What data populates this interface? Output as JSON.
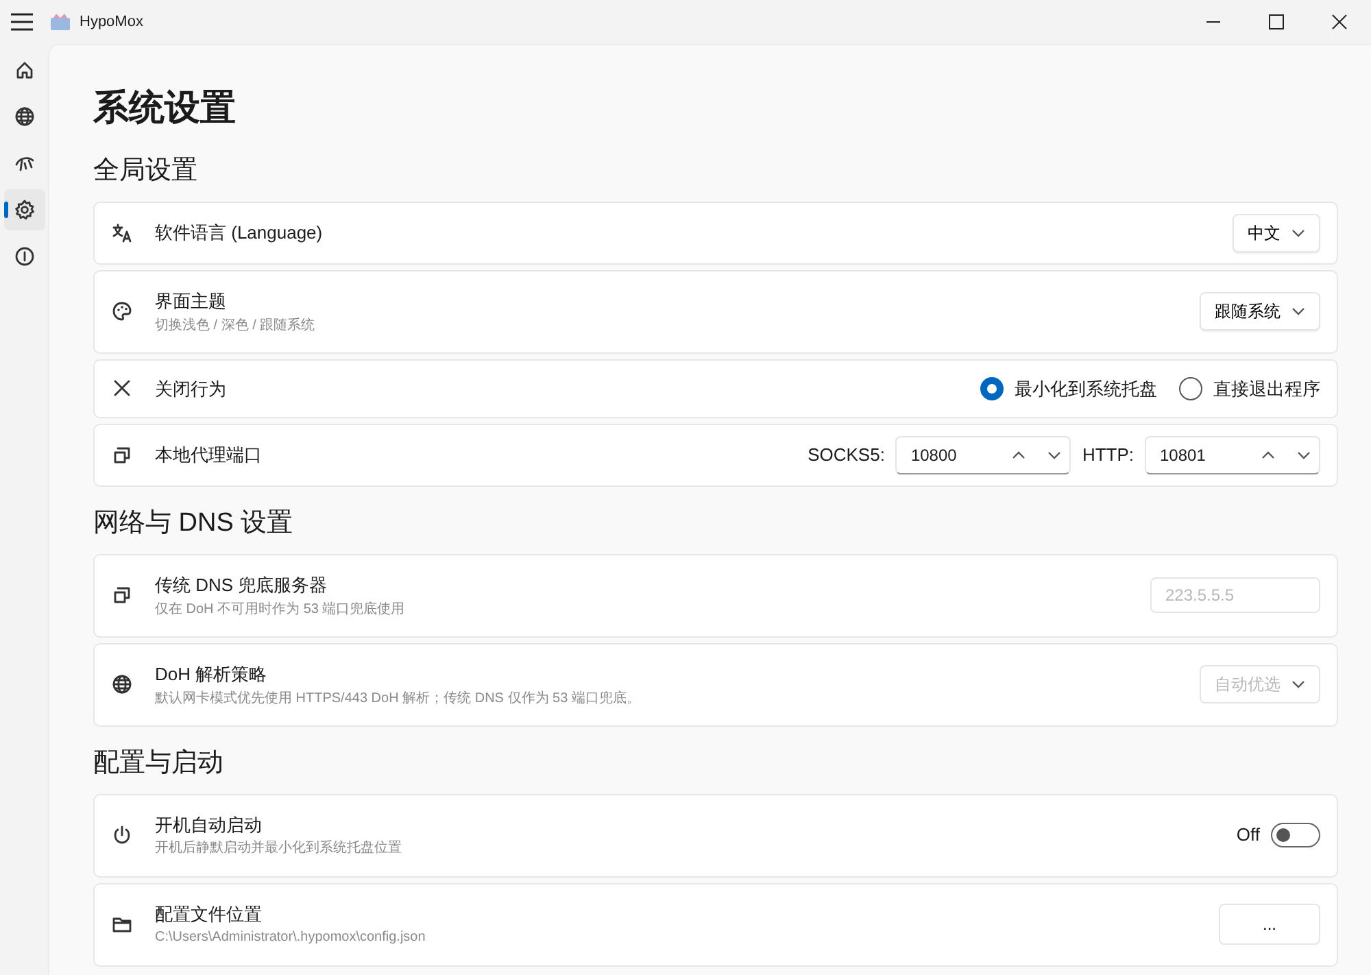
{
  "window": {
    "title": "HypoMox"
  },
  "nav": [
    {
      "kind": "home",
      "selected": false
    },
    {
      "kind": "globe",
      "selected": false
    },
    {
      "kind": "speed",
      "selected": false
    },
    {
      "kind": "settings",
      "selected": true
    },
    {
      "kind": "info",
      "selected": false
    }
  ],
  "page_title": "系统设置",
  "sections": [
    {
      "title": "全局设置",
      "rows": [
        {
          "kind": "dropdown",
          "label": "软件语言 (Language)",
          "value": "中文",
          "disabled": false
        },
        {
          "kind": "dropdown",
          "label": "界面主题",
          "description": "切换浅色 / 深色 / 跟随系统",
          "value": "跟随系统",
          "disabled": false
        },
        {
          "kind": "radio",
          "label": "关闭行为",
          "options": [
            {
              "label": "最小化到系统托盘",
              "selected": true
            },
            {
              "label": "直接退出程序",
              "selected": false
            }
          ]
        },
        {
          "kind": "ports",
          "label": "本地代理端口",
          "fields": [
            {
              "label": "SOCKS5:",
              "value": "10800"
            },
            {
              "label": "HTTP:",
              "value": "10801"
            }
          ]
        }
      ]
    },
    {
      "title": "网络与 DNS 设置",
      "rows": [
        {
          "kind": "textbox",
          "label": "传统 DNS 兜底服务器",
          "description": "仅在 DoH 不可用时作为 53 端口兜底使用",
          "value": "223.5.5.5",
          "disabled": true
        },
        {
          "kind": "dropdown",
          "label": "DoH 解析策略",
          "description": "默认网卡模式优先使用 HTTPS/443 DoH 解析；传统 DNS 仅作为 53 端口兜底。",
          "value": "自动优选",
          "disabled": true
        }
      ]
    },
    {
      "title": "配置与启动",
      "rows": [
        {
          "kind": "toggle",
          "label": "开机自动启动",
          "description": "开机后静默启动并最小化到系统托盘位置",
          "state_label": "Off",
          "on": false
        },
        {
          "kind": "button",
          "label": "配置文件位置",
          "description": "C:\\Users\\Administrator\\.hypomox\\config.json",
          "button_label": "..."
        }
      ]
    }
  ]
}
